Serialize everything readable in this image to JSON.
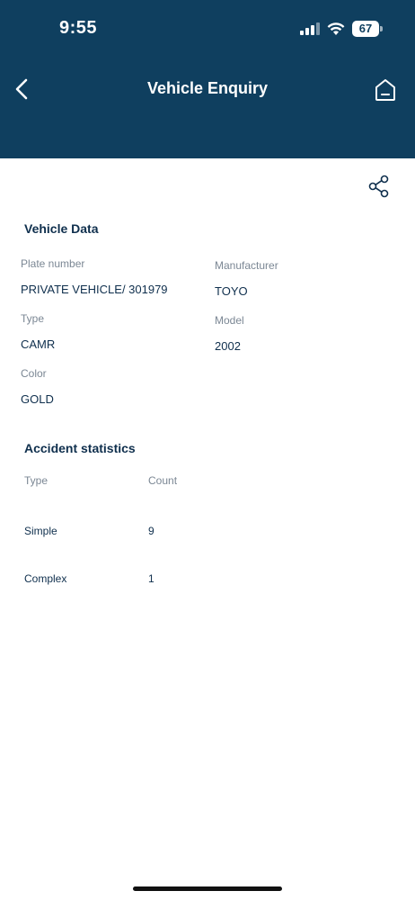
{
  "status_bar": {
    "time": "9:55",
    "battery": "67"
  },
  "header": {
    "title": "Vehicle Enquiry"
  },
  "vehicle_data": {
    "section_title": "Vehicle Data",
    "plate_number_label": "Plate number",
    "plate_number_value": "PRIVATE VEHICLE/ 301979",
    "manufacturer_label": "Manufacturer",
    "manufacturer_value": "TOYO",
    "type_label": "Type",
    "type_value": "CAMR",
    "model_label": "Model",
    "model_value": "2002",
    "color_label": "Color",
    "color_value": "GOLD"
  },
  "accident_statistics": {
    "section_title": "Accident statistics",
    "columns": [
      "Type",
      "Count"
    ],
    "rows": [
      {
        "type": "Simple",
        "count": "9"
      },
      {
        "type": "Complex",
        "count": "1"
      }
    ]
  },
  "icons": {
    "back": "chevron-left-icon",
    "home": "home-icon",
    "share": "share-icon"
  },
  "colors": {
    "header": "#0f3f5f",
    "text": "#0f2f4d",
    "label": "#7b8794"
  }
}
